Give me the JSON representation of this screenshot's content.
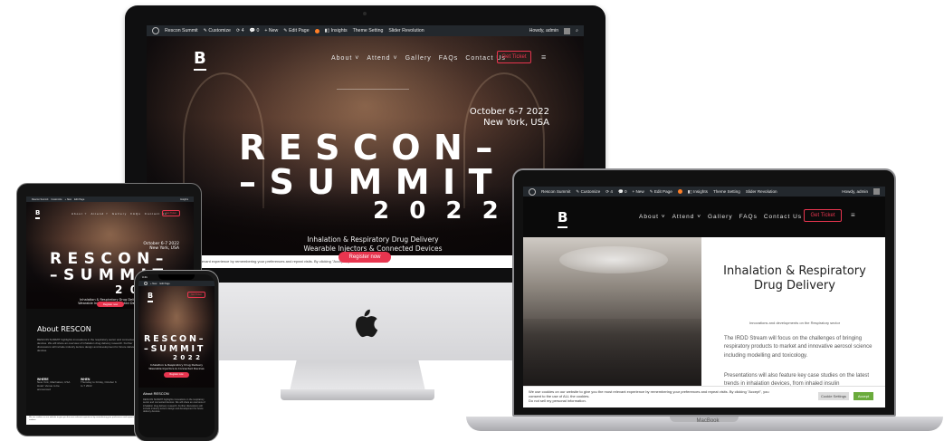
{
  "admin_bar": {
    "site": "Rescon Summit",
    "customize": "Customize",
    "updates": "4",
    "comments": "0",
    "new": "+ New",
    "edit": "Edit Page",
    "insights": "Insights",
    "theme_setting": "Theme Setting",
    "slider": "Slider Revolution",
    "howdy": "Howdy, admin"
  },
  "nav": {
    "logo": "B",
    "items": [
      "About ˅",
      "Attend ˅",
      "Gallery",
      "FAQs",
      "Contact Us"
    ],
    "ticket": "Get Ticket",
    "menu_icon": "≡"
  },
  "hero": {
    "date": "October 6-7 2022",
    "location": "New York, USA",
    "title_line1": "RESCON–",
    "title_line2": "–SUMMIT",
    "title_line3": "2022",
    "subtitle1": "Inhalation & Respiratory Drug Delivery",
    "subtitle2": "Wearable Injectors & Connected Devices",
    "register": "Register now",
    "cookie_text": "…bsite to give you the most relevant experience by remembering your preferences and repeat visits. By clicking \"Accept\", you consent to the use of"
  },
  "laptop": {
    "heading": "Inhalation & Respiratory Drug Delivery",
    "subheading": "Innovations and developments on the Respiratory sector",
    "para1": "The IRDD Stream will focus on the challenges of bringing respiratory products to market and innovative aerosol science including modelling and toxicology.",
    "para2": "Presentations will also feature key case studies on the latest trends in inhalation devices, from inhaled insulin",
    "cookie_text": "We use cookies on our website to give you the most relevant experience by remembering your preferences and repeat visits. By clicking \"Accept\", you consent to the use of ALL the cookies.",
    "cookie_text2": "Do not sell my personal information.",
    "cookie_settings": "Cookie Settings",
    "accept": "Accept",
    "brand": "MacBook"
  },
  "tablet": {
    "about_heading": "About RESCON",
    "about_text": "RESCON SUMMIT highlights innovations in the respiratory sector and connected devices. We will share an overview of inhalation drug delivery research. Further discussions will include industry lecture design and development for future delivery devices.",
    "where_label": "WHERE",
    "where_value": "New York, Manhattan, USA",
    "where_value2": "Hotel: Venue to be announced",
    "when_label": "WHEN",
    "when_value": "Thursday to Friday, October 6 to 7 2022"
  },
  "phone": {
    "time": "9:41",
    "about_heading": "About RESCON",
    "about_text": "RESCON SUMMIT highlights innovations in the respiratory sector and connected devices. We will share an overview of inhalation drug delivery research. Further discussions will include industry lecture design and development for future delivery devices."
  },
  "colors": {
    "accent": "#e8354f",
    "admin_bar": "#23282d",
    "accept_green": "#6aab3c"
  }
}
